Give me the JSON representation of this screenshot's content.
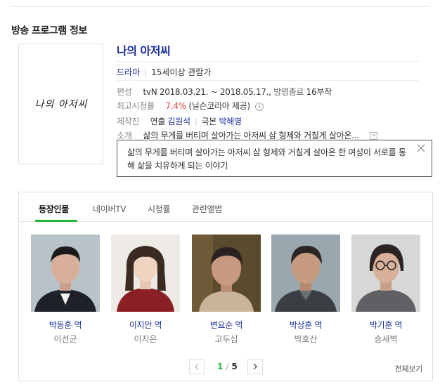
{
  "section_title": "방송 프로그램 정보",
  "program": {
    "title": "나의 아저씨",
    "poster_calligraphy": "나의 아저씨",
    "genre": "드라마",
    "age_rating": "15세이상 관람가",
    "broadcast": {
      "label": "편성",
      "network": "tvN",
      "period": "2018.03.21. ~ 2018.05.17.",
      "status": "방영종료",
      "episodes": "16부작"
    },
    "viewership": {
      "label": "최고시청률",
      "value": "7.4%",
      "source": "(닐슨코리아 제공)"
    },
    "staff": {
      "label": "제작진",
      "director_label": "연출",
      "director": "김원석",
      "writer_label": "극본",
      "writer": "박해영"
    },
    "intro": {
      "label": "소개",
      "short": "삶의 무게를 버티며 살아가는 아저씨 삼 형제와 거칠게 살아온...",
      "collapse_symbol": "−"
    },
    "synopsis": "삶의 무게를 버티며 살아가는 아저씨 삼 형제와 거칠게 살아온 한 여성이 서로를 통해 삶을 치유하게 되는 이야기"
  },
  "tabs": [
    {
      "label": "등장인물"
    },
    {
      "label": "네이버TV"
    },
    {
      "label": "시청률"
    },
    {
      "label": "관련앨범"
    }
  ],
  "cast": [
    {
      "role": "박동훈 역",
      "actor": "이선균"
    },
    {
      "role": "이지안 역",
      "actor": "이지은"
    },
    {
      "role": "변요순 역",
      "actor": "고두심"
    },
    {
      "role": "박상훈 역",
      "actor": "박호산"
    },
    {
      "role": "박기훈 역",
      "actor": "송새벽"
    }
  ],
  "pagination": {
    "current": "1",
    "separator": "/",
    "total": "5"
  },
  "view_all": "전체보기",
  "colors": {
    "link": "#1a2e9b",
    "accent_green": "#25b83a",
    "rating_red": "#e0443e"
  },
  "icons": {
    "info": "info-icon",
    "collapse": "collapse-icon",
    "close": "close-icon",
    "prev": "chevron-left-icon",
    "next": "chevron-right-icon"
  }
}
